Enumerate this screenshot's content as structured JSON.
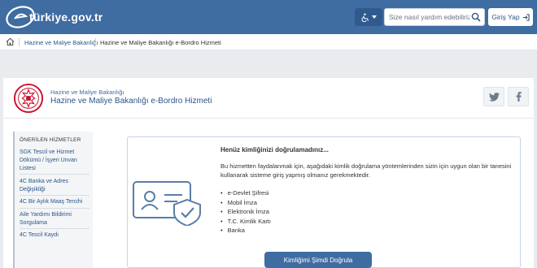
{
  "header": {
    "logo_text": "türkiye.gov.tr",
    "search_placeholder": "Size nasıl yardım edebiliriz?",
    "login_label": "Giriş Yap"
  },
  "breadcrumb": {
    "items": [
      "Hazine ve Maliye Bakanlığı",
      "Hazine ve Maliye Bakanlığı e-Bordro Hizmeti"
    ]
  },
  "service": {
    "ministry": "Hazine ve Maliye Bakanlığı",
    "title": "Hazine ve Maliye Bakanlığı e-Bordro Hizmeti"
  },
  "sidebar": {
    "title": "ÖNERİLEN HİZMETLER",
    "items": [
      {
        "label": "SGK Tescil ve Hizmet Dökümü / İşyeri Unvan Listesi"
      },
      {
        "label": "4C Banka ve Adres Değişikliği"
      },
      {
        "label": "4C Bir Aylık Maaş Tercihi"
      },
      {
        "label": "Aile Yardımı Bildirimi Sorgulama"
      },
      {
        "label": "4C Tescil Kaydı"
      }
    ]
  },
  "notice": {
    "title": "Henüz kimliğinizi doğrulamadınız...",
    "description": "Bu hizmetten faydalanmak için, aşağıdaki kimlik doğrulama yöntemlerinden sizin için uygun olan bir tanesini kullanarak sisteme giriş yapmış olmanız gerekmektedir.",
    "methods": [
      "e-Devlet Şifresi",
      "Mobil İmza",
      "Elektronik İmza",
      "T.C. Kimlik Kartı",
      "Banka"
    ],
    "verify_button": "Kimliğimi Şimdi Doğrula"
  },
  "colors": {
    "header_bg": "#3f6ca1",
    "link": "#2b5587",
    "ministry_red": "#c8102e"
  },
  "icons": [
    "logo-e-icon",
    "accessibility-icon",
    "chevron-down-icon",
    "search-icon",
    "login-icon",
    "home-icon",
    "ministry-seal-icon",
    "twitter-icon",
    "facebook-icon",
    "id-card-shield-icon"
  ]
}
